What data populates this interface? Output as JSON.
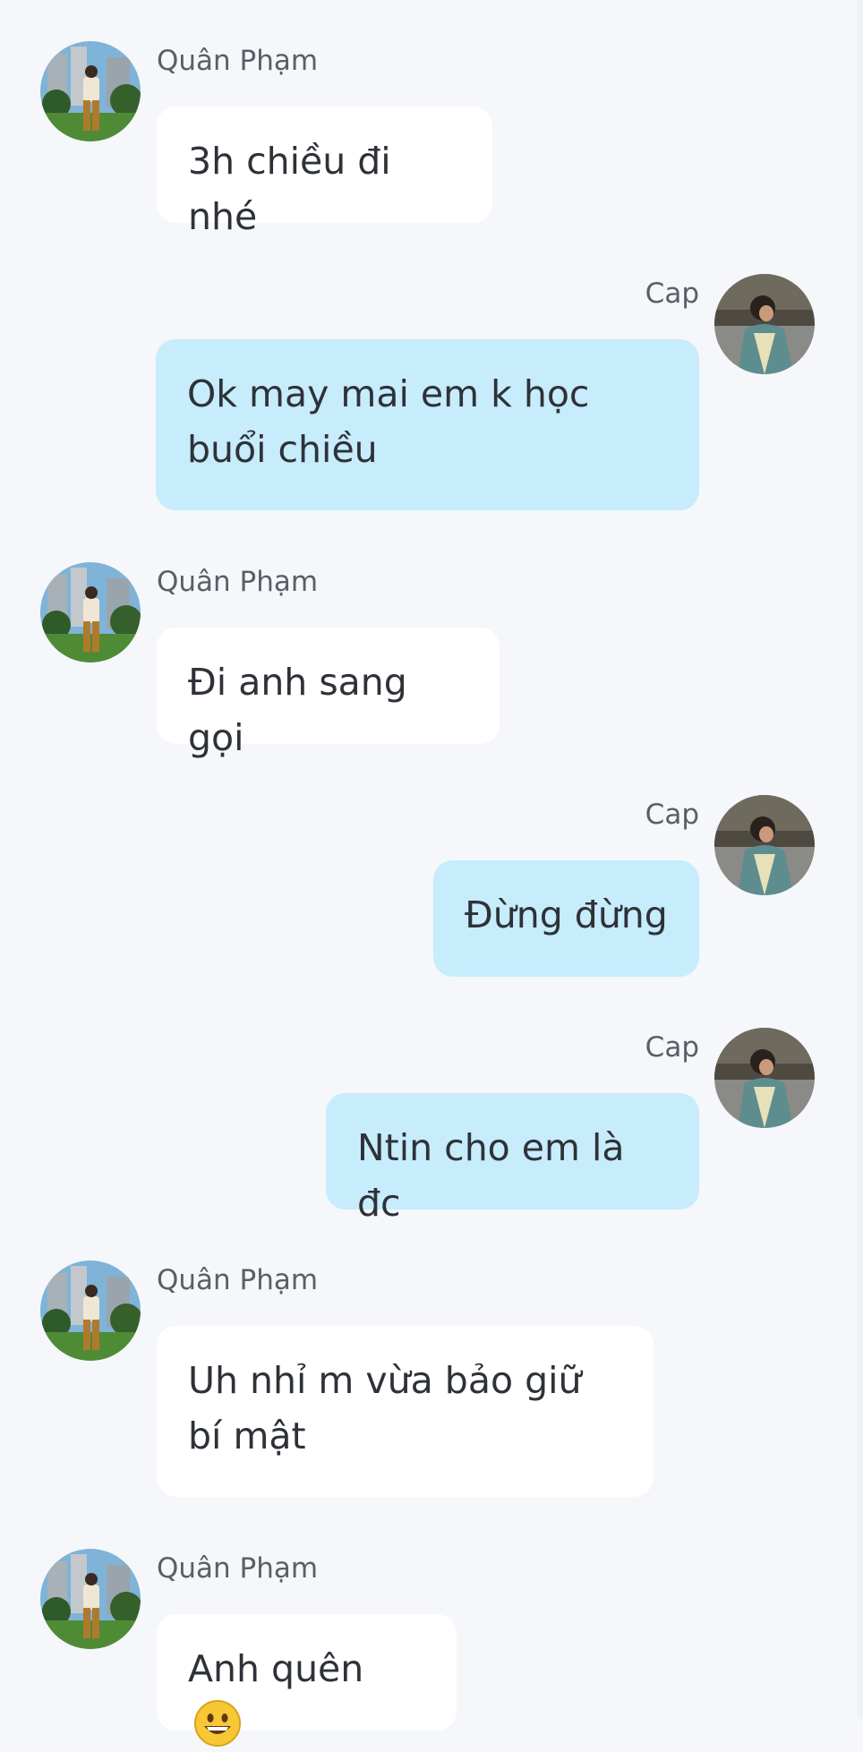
{
  "messages": [
    {
      "sender": "Quân Phạm",
      "text": "3h chiều đi nhé"
    },
    {
      "sender": "Cap",
      "text": "Ok may mai em k học buổi chiều"
    },
    {
      "sender": "Quân Phạm",
      "text": "Đi anh sang gọi"
    },
    {
      "sender": "Cap",
      "text": "Đừng đừng"
    },
    {
      "sender": "Cap",
      "text": "Ntin cho em là đc"
    },
    {
      "sender": "Quân Phạm",
      "text": "Uh nhỉ m vừa bảo giữ bí mật"
    },
    {
      "sender": "Quân Phạm",
      "text": "Anh quên",
      "emoji": "grinning-face-emoji"
    }
  ],
  "colors": {
    "background": "#f5f7fa",
    "incoming_bubble": "#ffffff",
    "outgoing_bubble": "#c7ecfc",
    "text": "#2e3238",
    "sender_name": "#5a5f66"
  }
}
